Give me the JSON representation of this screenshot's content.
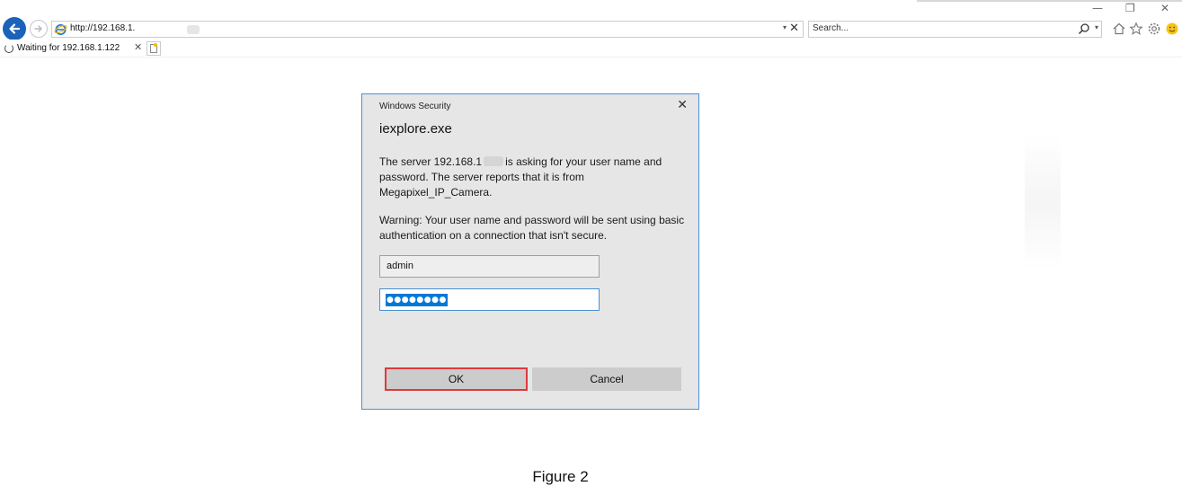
{
  "browser": {
    "address": "http://192.168.1.",
    "search_placeholder": "Search...",
    "tab_title": "Waiting for 192.168.1.122",
    "window_controls": {
      "minimize": "—",
      "restore": "❐",
      "close": "✕"
    },
    "icons": [
      "back-arrow-icon",
      "forward-arrow-icon",
      "ie-logo-icon",
      "search-icon",
      "home-icon",
      "favorites-star-icon",
      "settings-gear-icon",
      "smiley-feedback-icon",
      "new-tab-icon",
      "loading-spinner-icon"
    ]
  },
  "dialog": {
    "caption": "Windows Security",
    "close_glyph": "✕",
    "title": "iexplore.exe",
    "message_part1": "The server 192.168.1",
    "message_part2": "is asking for your user name and password. The server reports that it is from Megapixel_IP_Camera.",
    "warning": "Warning: Your user name and password will be sent using basic authentication on a connection that isn't secure.",
    "username_value": "admin",
    "password_mask": "●●●●●●●●",
    "ok_label": "OK",
    "cancel_label": "Cancel",
    "highlight_color": "#e0383e"
  },
  "figure_caption": "Figure 2"
}
